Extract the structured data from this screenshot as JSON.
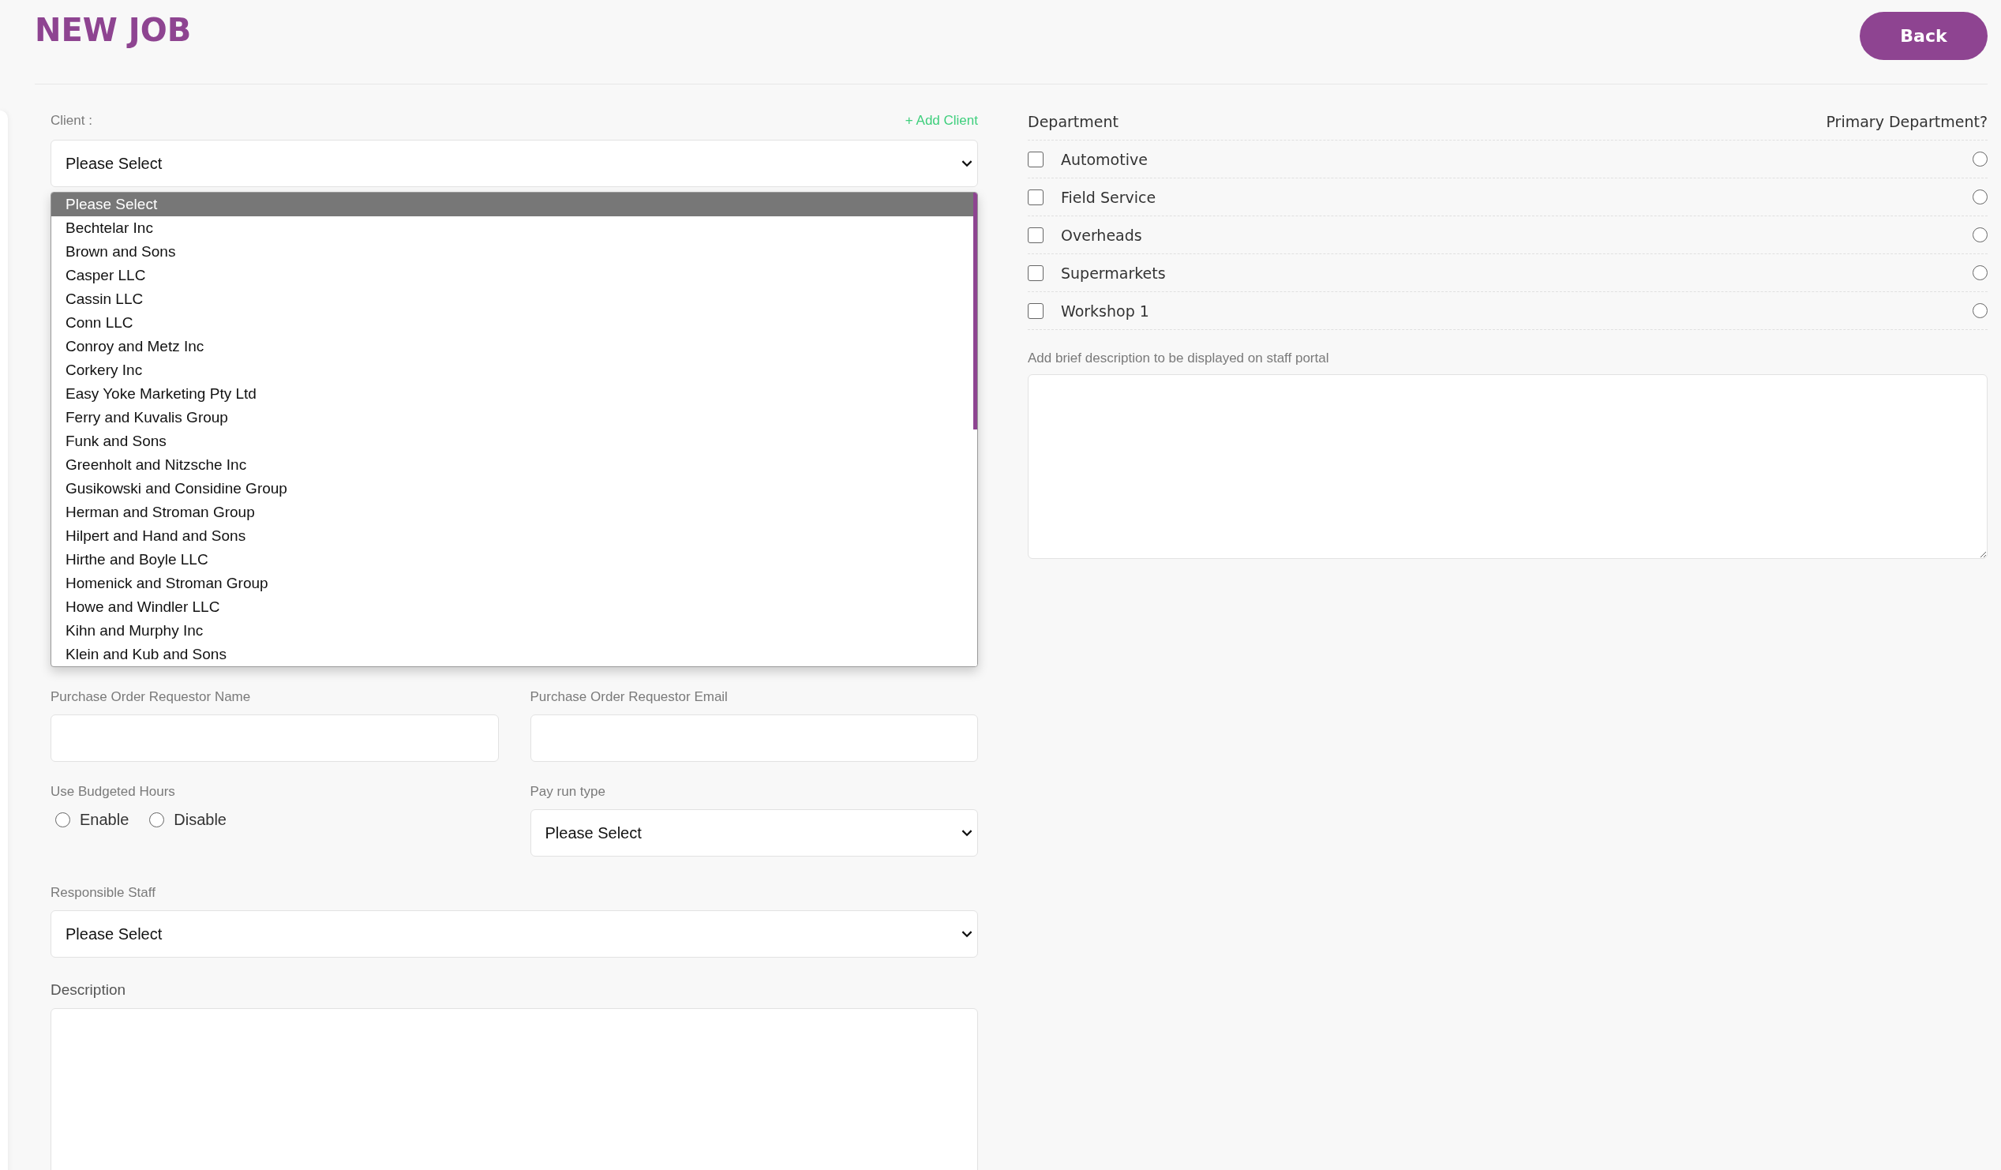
{
  "page": {
    "title": "NEW JOB",
    "back_button": "Back"
  },
  "client": {
    "label": "Client :",
    "add_link": "+ Add Client",
    "value": "Please Select",
    "options": [
      {
        "label": "Please Select",
        "selected": true
      },
      {
        "label": "Bechtelar Inc",
        "selected": false
      },
      {
        "label": "Brown and Sons",
        "selected": false
      },
      {
        "label": "Casper LLC",
        "selected": false
      },
      {
        "label": "Cassin LLC",
        "selected": false
      },
      {
        "label": "Conn LLC",
        "selected": false
      },
      {
        "label": "Conroy and Metz Inc",
        "selected": false
      },
      {
        "label": "Corkery Inc",
        "selected": false
      },
      {
        "label": "Easy Yoke Marketing Pty Ltd",
        "selected": false
      },
      {
        "label": "Ferry and Kuvalis Group",
        "selected": false
      },
      {
        "label": "Funk and Sons",
        "selected": false
      },
      {
        "label": "Greenholt and Nitzsche Inc",
        "selected": false
      },
      {
        "label": "Gusikowski and Considine Group",
        "selected": false
      },
      {
        "label": "Herman and Stroman Group",
        "selected": false
      },
      {
        "label": "Hilpert and Hand and Sons",
        "selected": false
      },
      {
        "label": "Hirthe and Boyle LLC",
        "selected": false
      },
      {
        "label": "Homenick and Stroman Group",
        "selected": false
      },
      {
        "label": "Howe and Windler LLC",
        "selected": false
      },
      {
        "label": "Kihn and Murphy Inc",
        "selected": false
      },
      {
        "label": "Klein and Kub and Sons",
        "selected": false
      }
    ]
  },
  "po_requestor_name": {
    "label": "Purchase Order Requestor Name"
  },
  "po_requestor_email": {
    "label": "Purchase Order Requestor Email"
  },
  "budgeted_hours": {
    "label": "Use Budgeted Hours",
    "options": [
      {
        "label": "Enable",
        "selected": false
      },
      {
        "label": "Disable",
        "selected": false
      }
    ]
  },
  "pay_run_type": {
    "label": "Pay run type",
    "value": "Please Select"
  },
  "responsible_staff": {
    "label": "Responsible Staff",
    "value": "Please Select"
  },
  "description": {
    "label": "Description"
  },
  "departments": {
    "header": "Department",
    "primary_header": "Primary Department?",
    "items": [
      {
        "name": "Automotive",
        "checked": false,
        "primary": false
      },
      {
        "name": "Field Service",
        "checked": false,
        "primary": false
      },
      {
        "name": "Overheads",
        "checked": false,
        "primary": false
      },
      {
        "name": "Supermarkets",
        "checked": false,
        "primary": false
      },
      {
        "name": "Workshop 1",
        "checked": false,
        "primary": false
      }
    ]
  },
  "portal_description": {
    "label": "Add brief description to be displayed on staff portal"
  }
}
